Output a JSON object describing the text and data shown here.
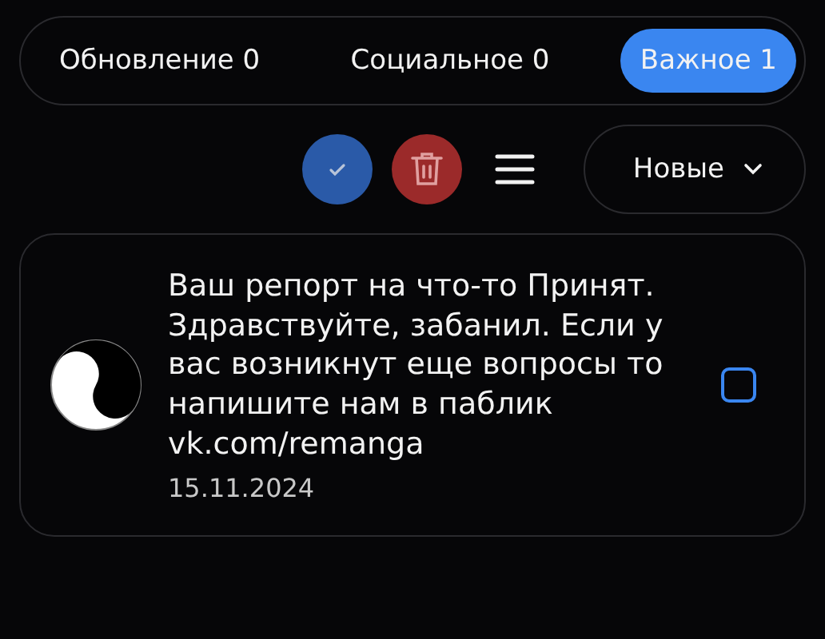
{
  "tabs": [
    {
      "label": "Обновление 0",
      "selected": false
    },
    {
      "label": "Социальное 0",
      "selected": false
    },
    {
      "label": "Важное 1",
      "selected": true
    }
  ],
  "sort": {
    "label": "Новые"
  },
  "notifications": [
    {
      "text": "Ваш репорт на что-то Принят. Здравствуйте, забанил. Если у вас возникнут еще вопросы то напишите нам в паблик vk.com/remanga",
      "date": "15.11.2024",
      "checked": false
    }
  ]
}
